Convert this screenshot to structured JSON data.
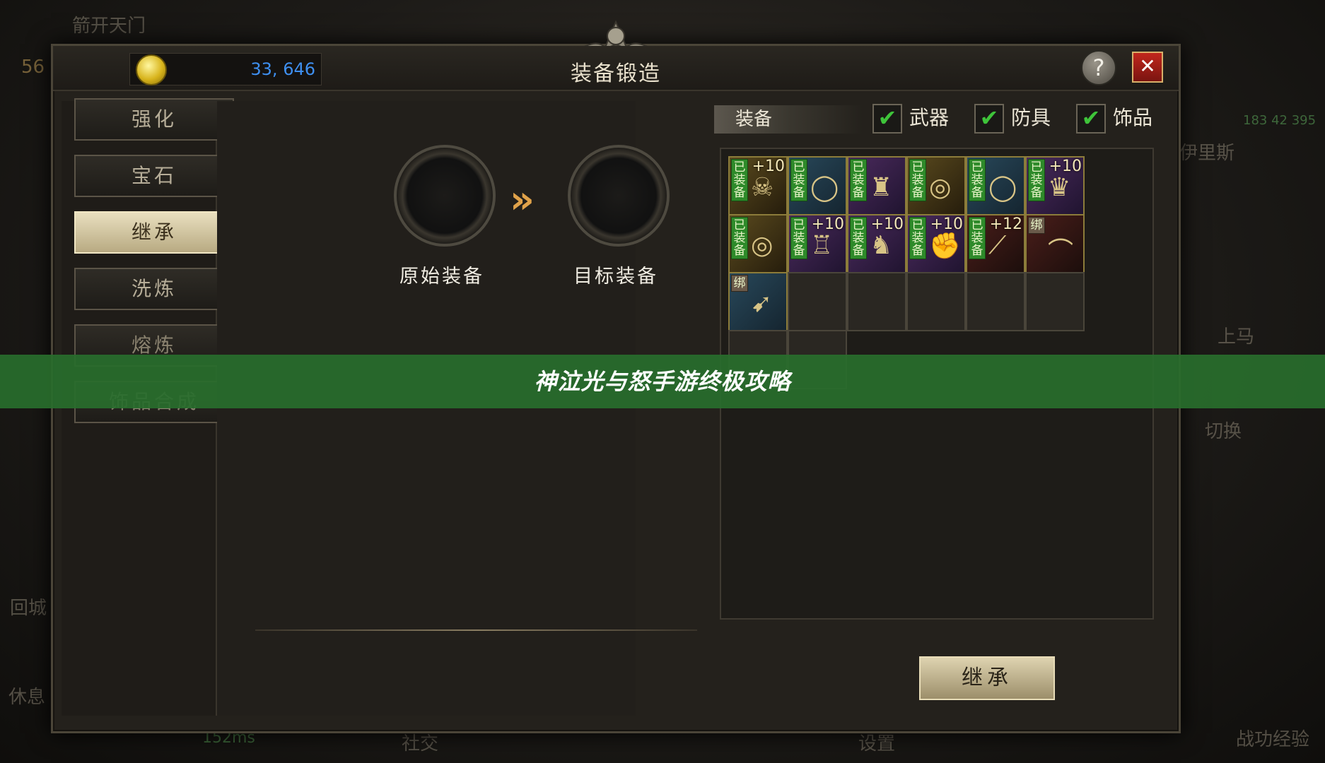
{
  "background_labels": {
    "top_left": "箭开天门",
    "level": "56",
    "right_name": "伊里斯",
    "coords": "183 42 395",
    "mount": "上马",
    "switch": "切换",
    "return_city": "回城",
    "rest": "休息",
    "ping": "152ms",
    "social": "社交",
    "settings": "设置",
    "combat_exp": "战功经验"
  },
  "window": {
    "title": "装备锻造",
    "gold": "33, 646",
    "help_label": "?",
    "close_label": "✕"
  },
  "nav": {
    "items": [
      {
        "label": "强化",
        "state": "normal"
      },
      {
        "label": "宝石",
        "state": "normal"
      },
      {
        "label": "继承",
        "state": "active"
      },
      {
        "label": "洗炼",
        "state": "normal"
      },
      {
        "label": "熔炼",
        "state": "dim"
      },
      {
        "label": "饰品合成",
        "state": "dim"
      }
    ]
  },
  "inherit": {
    "source_label": "原始装备",
    "target_label": "目标装备",
    "arrow": "»"
  },
  "equip_list": {
    "tab_label": "装备",
    "filters": [
      {
        "label": "武器",
        "checked": true
      },
      {
        "label": "防具",
        "checked": true
      },
      {
        "label": "饰品",
        "checked": true
      }
    ],
    "equipped_badge": "已装备",
    "bound_badge": "绑",
    "items": [
      {
        "badge": "equipped",
        "plus": "+10",
        "icon": "mask-icon",
        "tone": "gold"
      },
      {
        "badge": "equipped",
        "plus": "",
        "icon": "ring-icon",
        "tone": "blue"
      },
      {
        "badge": "equipped",
        "plus": "",
        "icon": "robe-icon",
        "tone": "purple"
      },
      {
        "badge": "equipped",
        "plus": "",
        "icon": "gold-ring-icon",
        "tone": "gold"
      },
      {
        "badge": "equipped",
        "plus": "",
        "icon": "ring-icon",
        "tone": "blue"
      },
      {
        "badge": "equipped",
        "plus": "+10",
        "icon": "helmet-icon",
        "tone": "purple"
      },
      {
        "badge": "equipped",
        "plus": "",
        "icon": "gold-ring-icon",
        "tone": "gold"
      },
      {
        "badge": "equipped",
        "plus": "+10",
        "icon": "armor-icon",
        "tone": "purple"
      },
      {
        "badge": "equipped",
        "plus": "+10",
        "icon": "boots-icon",
        "tone": "purple"
      },
      {
        "badge": "equipped",
        "plus": "+10",
        "icon": "gauntlet-icon",
        "tone": "purple"
      },
      {
        "badge": "equipped",
        "plus": "+12",
        "icon": "staff-icon",
        "tone": "red"
      },
      {
        "badge": "bound",
        "plus": "",
        "icon": "bow-icon",
        "tone": "red"
      },
      {
        "badge": "bound",
        "plus": "",
        "icon": "spear-icon",
        "tone": "blue"
      }
    ],
    "inherit_button": "继承"
  },
  "banner": {
    "text": "神泣光与怒手游终极攻略"
  }
}
